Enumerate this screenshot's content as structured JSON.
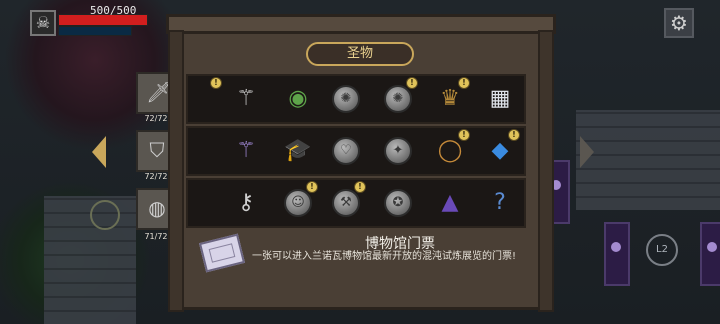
{
  "hud": {
    "hp_text": "500/500",
    "hp_fraction": 1.0,
    "avatar_icon": "skull-icon",
    "settings_icon": "gear-icon"
  },
  "cabinet": {
    "title": "圣物"
  },
  "categories": [
    {
      "icon": "sword-icon",
      "count": "72/72"
    },
    {
      "icon": "shield-icon",
      "count": "72/72"
    },
    {
      "icon": "bag-icon",
      "count": "71/72"
    }
  ],
  "shelves": [
    [
      {
        "name": "partial-item-icon",
        "glyph": "",
        "badge": true
      },
      {
        "name": "gem-staff-icon",
        "glyph": "⚚",
        "badge": false
      },
      {
        "name": "green-amulet-icon",
        "glyph": "◉",
        "badge": false,
        "color": "#5ea34a"
      },
      {
        "name": "silver-coin-icon",
        "glyph": "✺",
        "badge": false,
        "coin": true
      },
      {
        "name": "silver-coin-icon",
        "glyph": "✺",
        "badge": true,
        "coin": true
      },
      {
        "name": "horned-helmet-icon",
        "glyph": "♛",
        "badge": true,
        "color": "#b58a3a"
      },
      {
        "name": "paint-palette-icon",
        "glyph": "▦",
        "badge": false,
        "color": "#dfe3ea"
      }
    ],
    [
      {
        "name": "partial-item-icon",
        "glyph": "",
        "badge": false
      },
      {
        "name": "purple-staff-icon",
        "glyph": "⚚",
        "badge": false,
        "color": "#a38ad8"
      },
      {
        "name": "graduation-cap-icon",
        "glyph": "🎓",
        "badge": false
      },
      {
        "name": "heart-coin-icon",
        "glyph": "♡",
        "badge": false,
        "coin": true
      },
      {
        "name": "silver-coin-icon",
        "glyph": "✦",
        "badge": false,
        "coin": true
      },
      {
        "name": "ring-icon",
        "glyph": "◯",
        "badge": true,
        "color": "#c58a3a"
      },
      {
        "name": "blue-crystal-icon",
        "glyph": "◆",
        "badge": true,
        "color": "#3a8be0"
      }
    ],
    [
      {
        "name": "partial-item-icon",
        "glyph": "",
        "badge": false
      },
      {
        "name": "key-staff-icon",
        "glyph": "⚷",
        "badge": false
      },
      {
        "name": "face-coin-icon",
        "glyph": "☺",
        "badge": true,
        "coin": true
      },
      {
        "name": "hammer-coin-icon",
        "glyph": "⚒",
        "badge": true,
        "coin": true
      },
      {
        "name": "silver-coin-icon",
        "glyph": "✪",
        "badge": false,
        "coin": true
      },
      {
        "name": "wizard-hat-icon",
        "glyph": "▲",
        "badge": false,
        "color": "#6a4ab8"
      },
      {
        "name": "unknown-item-icon",
        "glyph": "?",
        "badge": false,
        "color": "#5a8ad0"
      }
    ]
  ],
  "selected_item": {
    "title": "博物馆门票",
    "description": "一张可以进入兰诺瓦博物馆最新开放的混沌试炼展览的门票!",
    "icon": "ticket-icon"
  },
  "controls": {
    "l2_label": "L2"
  }
}
